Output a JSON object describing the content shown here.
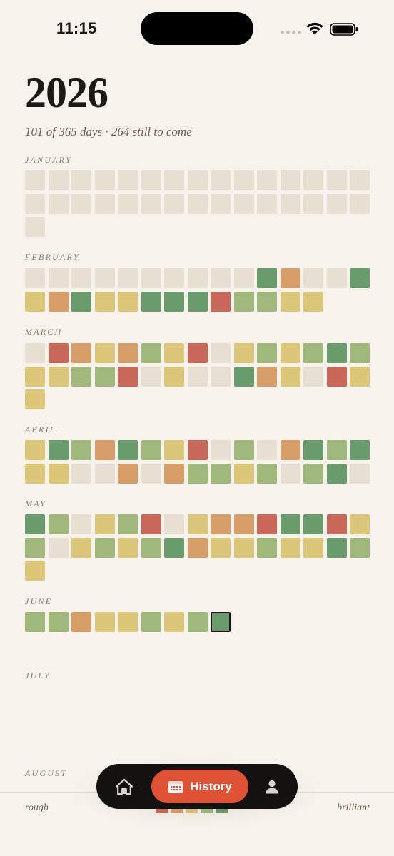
{
  "status_bar": {
    "time": "11:15"
  },
  "header": {
    "year": "2026",
    "subtitle": "101 of 365 days · 264 still to come"
  },
  "colors": {
    "background": "#f7f2eb",
    "empty": "#e8dfd3",
    "rough": "#c8685a",
    "meh": "#d89e69",
    "ok": "#dbc679",
    "good": "#a0b87c",
    "brilliant": "#699b6c",
    "accent": "#e05236",
    "tabbar": "#141211"
  },
  "rating_scale": [
    "rough",
    "meh",
    "ok",
    "good",
    "brilliant"
  ],
  "months": [
    {
      "name": "JANUARY",
      "days": [
        "empty",
        "empty",
        "empty",
        "empty",
        "empty",
        "empty",
        "empty",
        "empty",
        "empty",
        "empty",
        "empty",
        "empty",
        "empty",
        "empty",
        "empty",
        "empty",
        "empty",
        "empty",
        "empty",
        "empty",
        "empty",
        "empty",
        "empty",
        "empty",
        "empty",
        "empty",
        "empty",
        "empty",
        "empty",
        "empty",
        "empty"
      ]
    },
    {
      "name": "FEBRUARY",
      "days": [
        "empty",
        "empty",
        "empty",
        "empty",
        "empty",
        "empty",
        "empty",
        "empty",
        "empty",
        "empty",
        "brilliant",
        "meh",
        "empty",
        "empty",
        "brilliant",
        "ok",
        "meh",
        "brilliant",
        "ok",
        "ok",
        "brilliant",
        "brilliant",
        "brilliant",
        "rough",
        "good",
        "good",
        "ok",
        "ok"
      ]
    },
    {
      "name": "MARCH",
      "days": [
        "empty",
        "rough",
        "meh",
        "ok",
        "meh",
        "good",
        "ok",
        "rough",
        "empty",
        "ok",
        "good",
        "ok",
        "good",
        "brilliant",
        "good",
        "ok",
        "ok",
        "good",
        "good",
        "rough",
        "empty",
        "ok",
        "empty",
        "empty",
        "brilliant",
        "meh",
        "ok",
        "empty",
        "rough",
        "ok",
        "ok"
      ]
    },
    {
      "name": "APRIL",
      "days": [
        "ok",
        "brilliant",
        "good",
        "meh",
        "brilliant",
        "good",
        "ok",
        "rough",
        "empty",
        "good",
        "empty",
        "meh",
        "brilliant",
        "good",
        "brilliant",
        "ok",
        "ok",
        "empty",
        "empty",
        "meh",
        "empty",
        "meh",
        "good",
        "good",
        "ok",
        "good",
        "empty",
        "good",
        "brilliant",
        "empty"
      ]
    },
    {
      "name": "MAY",
      "days": [
        "brilliant",
        "good",
        "empty",
        "ok",
        "good",
        "rough",
        "empty",
        "ok",
        "meh",
        "meh",
        "rough",
        "brilliant",
        "brilliant",
        "rough",
        "ok",
        "good",
        "empty",
        "ok",
        "good",
        "ok",
        "good",
        "brilliant",
        "meh",
        "ok",
        "ok",
        "good",
        "ok",
        "ok",
        "brilliant",
        "good",
        "ok"
      ]
    },
    {
      "name": "JUNE",
      "days": [
        "good",
        "good",
        "meh",
        "ok",
        "ok",
        "good",
        "ok",
        "good",
        "brilliant"
      ]
    },
    {
      "name": "JULY",
      "days": []
    },
    {
      "name": "AUGUST",
      "days": []
    }
  ],
  "legend": {
    "low_label": "rough",
    "high_label": "brilliant"
  },
  "tab_bar": {
    "home_icon": "home-icon",
    "history_icon": "calendar-icon",
    "history_label": "History",
    "profile_icon": "person-icon",
    "active_tab": "History"
  }
}
